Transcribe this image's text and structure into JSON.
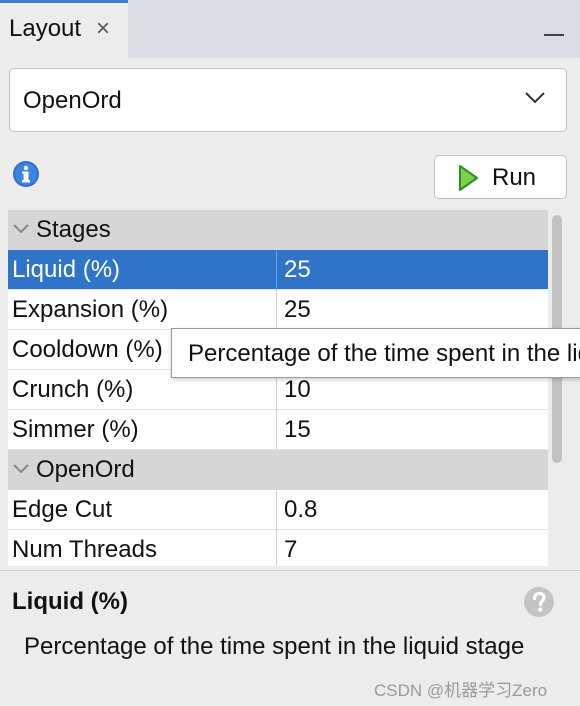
{
  "tab": {
    "title": "Layout",
    "close_glyph": "×"
  },
  "layout_select": {
    "value": "OpenOrd",
    "icon": "chevron-down-icon"
  },
  "toolbar": {
    "info_icon": "info-icon",
    "run_label": "Run",
    "run_icon": "play-icon"
  },
  "properties": {
    "groups": [
      {
        "label": "Stages",
        "rows": [
          {
            "name": "Liquid (%)",
            "value": "25",
            "selected": true
          },
          {
            "name": "Expansion (%)",
            "value": "25"
          },
          {
            "name": "Cooldown (%)",
            "value": ""
          },
          {
            "name": "Crunch (%)",
            "value": "10"
          },
          {
            "name": "Simmer (%)",
            "value": "15"
          }
        ]
      },
      {
        "label": "OpenOrd",
        "rows": [
          {
            "name": "Edge Cut",
            "value": "0.8"
          },
          {
            "name": "Num Threads",
            "value": "7"
          }
        ]
      }
    ]
  },
  "tooltip": {
    "text": "Percentage of the time spent in the liquid stage"
  },
  "description": {
    "title": "Liquid (%)",
    "text": "Percentage of the time spent in the liquid stage",
    "help_icon": "help-icon"
  },
  "watermark": "CSDN @机器学习Zero",
  "colors": {
    "selection": "#2f74c9",
    "group_header": "#d6d6d6",
    "accent": "#3a7bd5"
  }
}
